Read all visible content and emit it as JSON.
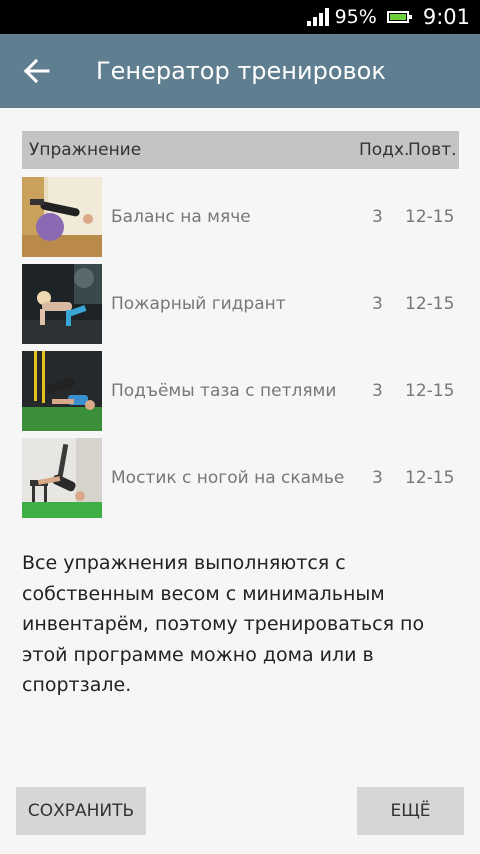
{
  "status_bar": {
    "battery_percent": "95%",
    "time": "9:01",
    "icons": [
      "signal-icon",
      "battery-icon"
    ]
  },
  "app_bar": {
    "title": "Генератор тренировок",
    "back_icon": "arrow-left-icon"
  },
  "table": {
    "headers": {
      "exercise": "Упражнение",
      "sets": "Подх.",
      "reps": "Повт."
    },
    "rows": [
      {
        "name": "Баланс на мяче",
        "sets": "3",
        "reps": "12-15"
      },
      {
        "name": "Пожарный гидрант",
        "sets": "3",
        "reps": "12-15"
      },
      {
        "name": "Подъёмы таза с петлями",
        "sets": "3",
        "reps": "12-15"
      },
      {
        "name": "Мостик с ногой на скамье",
        "sets": "3",
        "reps": "12-15"
      }
    ]
  },
  "description": "Все упражнения выполняются с собственным весом с минимальным инвентарём, поэтому тренироваться по этой программе можно дома или в спортзале.",
  "buttons": {
    "save": "СОХРАНИТЬ",
    "more": "ЕЩЁ"
  },
  "colors": {
    "app_bar": "#5f7e8f",
    "status_bar": "#000000",
    "table_header": "#c4c4c4",
    "button": "#d6d6d6",
    "background": "#f6f6f6"
  }
}
